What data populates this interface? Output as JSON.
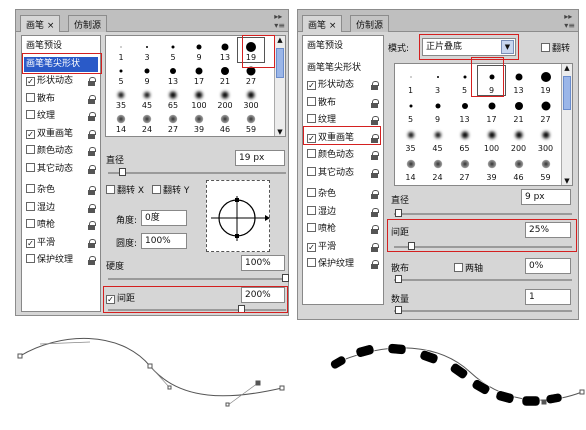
{
  "tabs": {
    "brush": "画笔",
    "clone_source": "仿制源",
    "close": "×"
  },
  "left_panel": {
    "preset_label": "画笔预设",
    "tip_label": "画笔笔尖形状",
    "options": [
      {
        "label": "形状动态",
        "checked": true
      },
      {
        "label": "散布",
        "checked": false
      },
      {
        "label": "纹理",
        "checked": false
      },
      {
        "label": "双重画笔",
        "checked": true
      },
      {
        "label": "颜色动态",
        "checked": false
      },
      {
        "label": "其它动态",
        "checked": false
      },
      {
        "label": "杂色",
        "checked": false
      },
      {
        "label": "湿边",
        "checked": false
      },
      {
        "label": "喷枪",
        "checked": false
      },
      {
        "label": "平滑",
        "checked": true
      },
      {
        "label": "保护纹理",
        "checked": false
      }
    ],
    "brush_sizes": [
      [
        "1",
        "3",
        "5",
        "9",
        "13",
        "19"
      ],
      [
        "5",
        "9",
        "13",
        "17",
        "21",
        "27"
      ],
      [
        "35",
        "45",
        "65",
        "100",
        "200",
        "300"
      ],
      [
        "14",
        "24",
        "27",
        "39",
        "46",
        "59"
      ]
    ],
    "diameter_label": "直径",
    "diameter_value": "19 px",
    "flip_x": "翻转 X",
    "flip_y": "翻转 Y",
    "angle_label": "角度:",
    "angle_value": "0度",
    "roundness_label": "圆度:",
    "roundness_value": "100%",
    "hardness_label": "硬度",
    "hardness_value": "100%",
    "spacing_label": "间距",
    "spacing_value": "200%",
    "spacing_checked": true
  },
  "right_panel": {
    "mode_label": "模式:",
    "mode_value": "正片叠底",
    "flip_label": "翻转",
    "preset_label": "画笔预设",
    "tip_label": "画笔笔尖形状",
    "options": [
      {
        "label": "形状动态",
        "checked": true
      },
      {
        "label": "散布",
        "checked": false
      },
      {
        "label": "纹理",
        "checked": false
      },
      {
        "label": "双重画笔",
        "checked": true
      },
      {
        "label": "颜色动态",
        "checked": false
      },
      {
        "label": "其它动态",
        "checked": false
      },
      {
        "label": "杂色",
        "checked": false
      },
      {
        "label": "湿边",
        "checked": false
      },
      {
        "label": "喷枪",
        "checked": false
      },
      {
        "label": "平滑",
        "checked": true
      },
      {
        "label": "保护纹理",
        "checked": false
      }
    ],
    "brush_sizes": [
      [
        "1",
        "3",
        "5",
        "9",
        "13",
        "19"
      ],
      [
        "5",
        "9",
        "13",
        "17",
        "21",
        "27"
      ],
      [
        "35",
        "45",
        "65",
        "100",
        "200",
        "300"
      ],
      [
        "14",
        "24",
        "27",
        "39",
        "46",
        "59"
      ]
    ],
    "diameter_label": "直径",
    "diameter_value": "9 px",
    "spacing_label": "间距",
    "spacing_value": "25%",
    "scatter_label": "散布",
    "both_axes_label": "两轴",
    "scatter_value": "0%",
    "count_label": "数量",
    "count_value": "1"
  },
  "colors": {
    "highlight": "#2a5ac8",
    "red_annotation": "#d42020"
  }
}
